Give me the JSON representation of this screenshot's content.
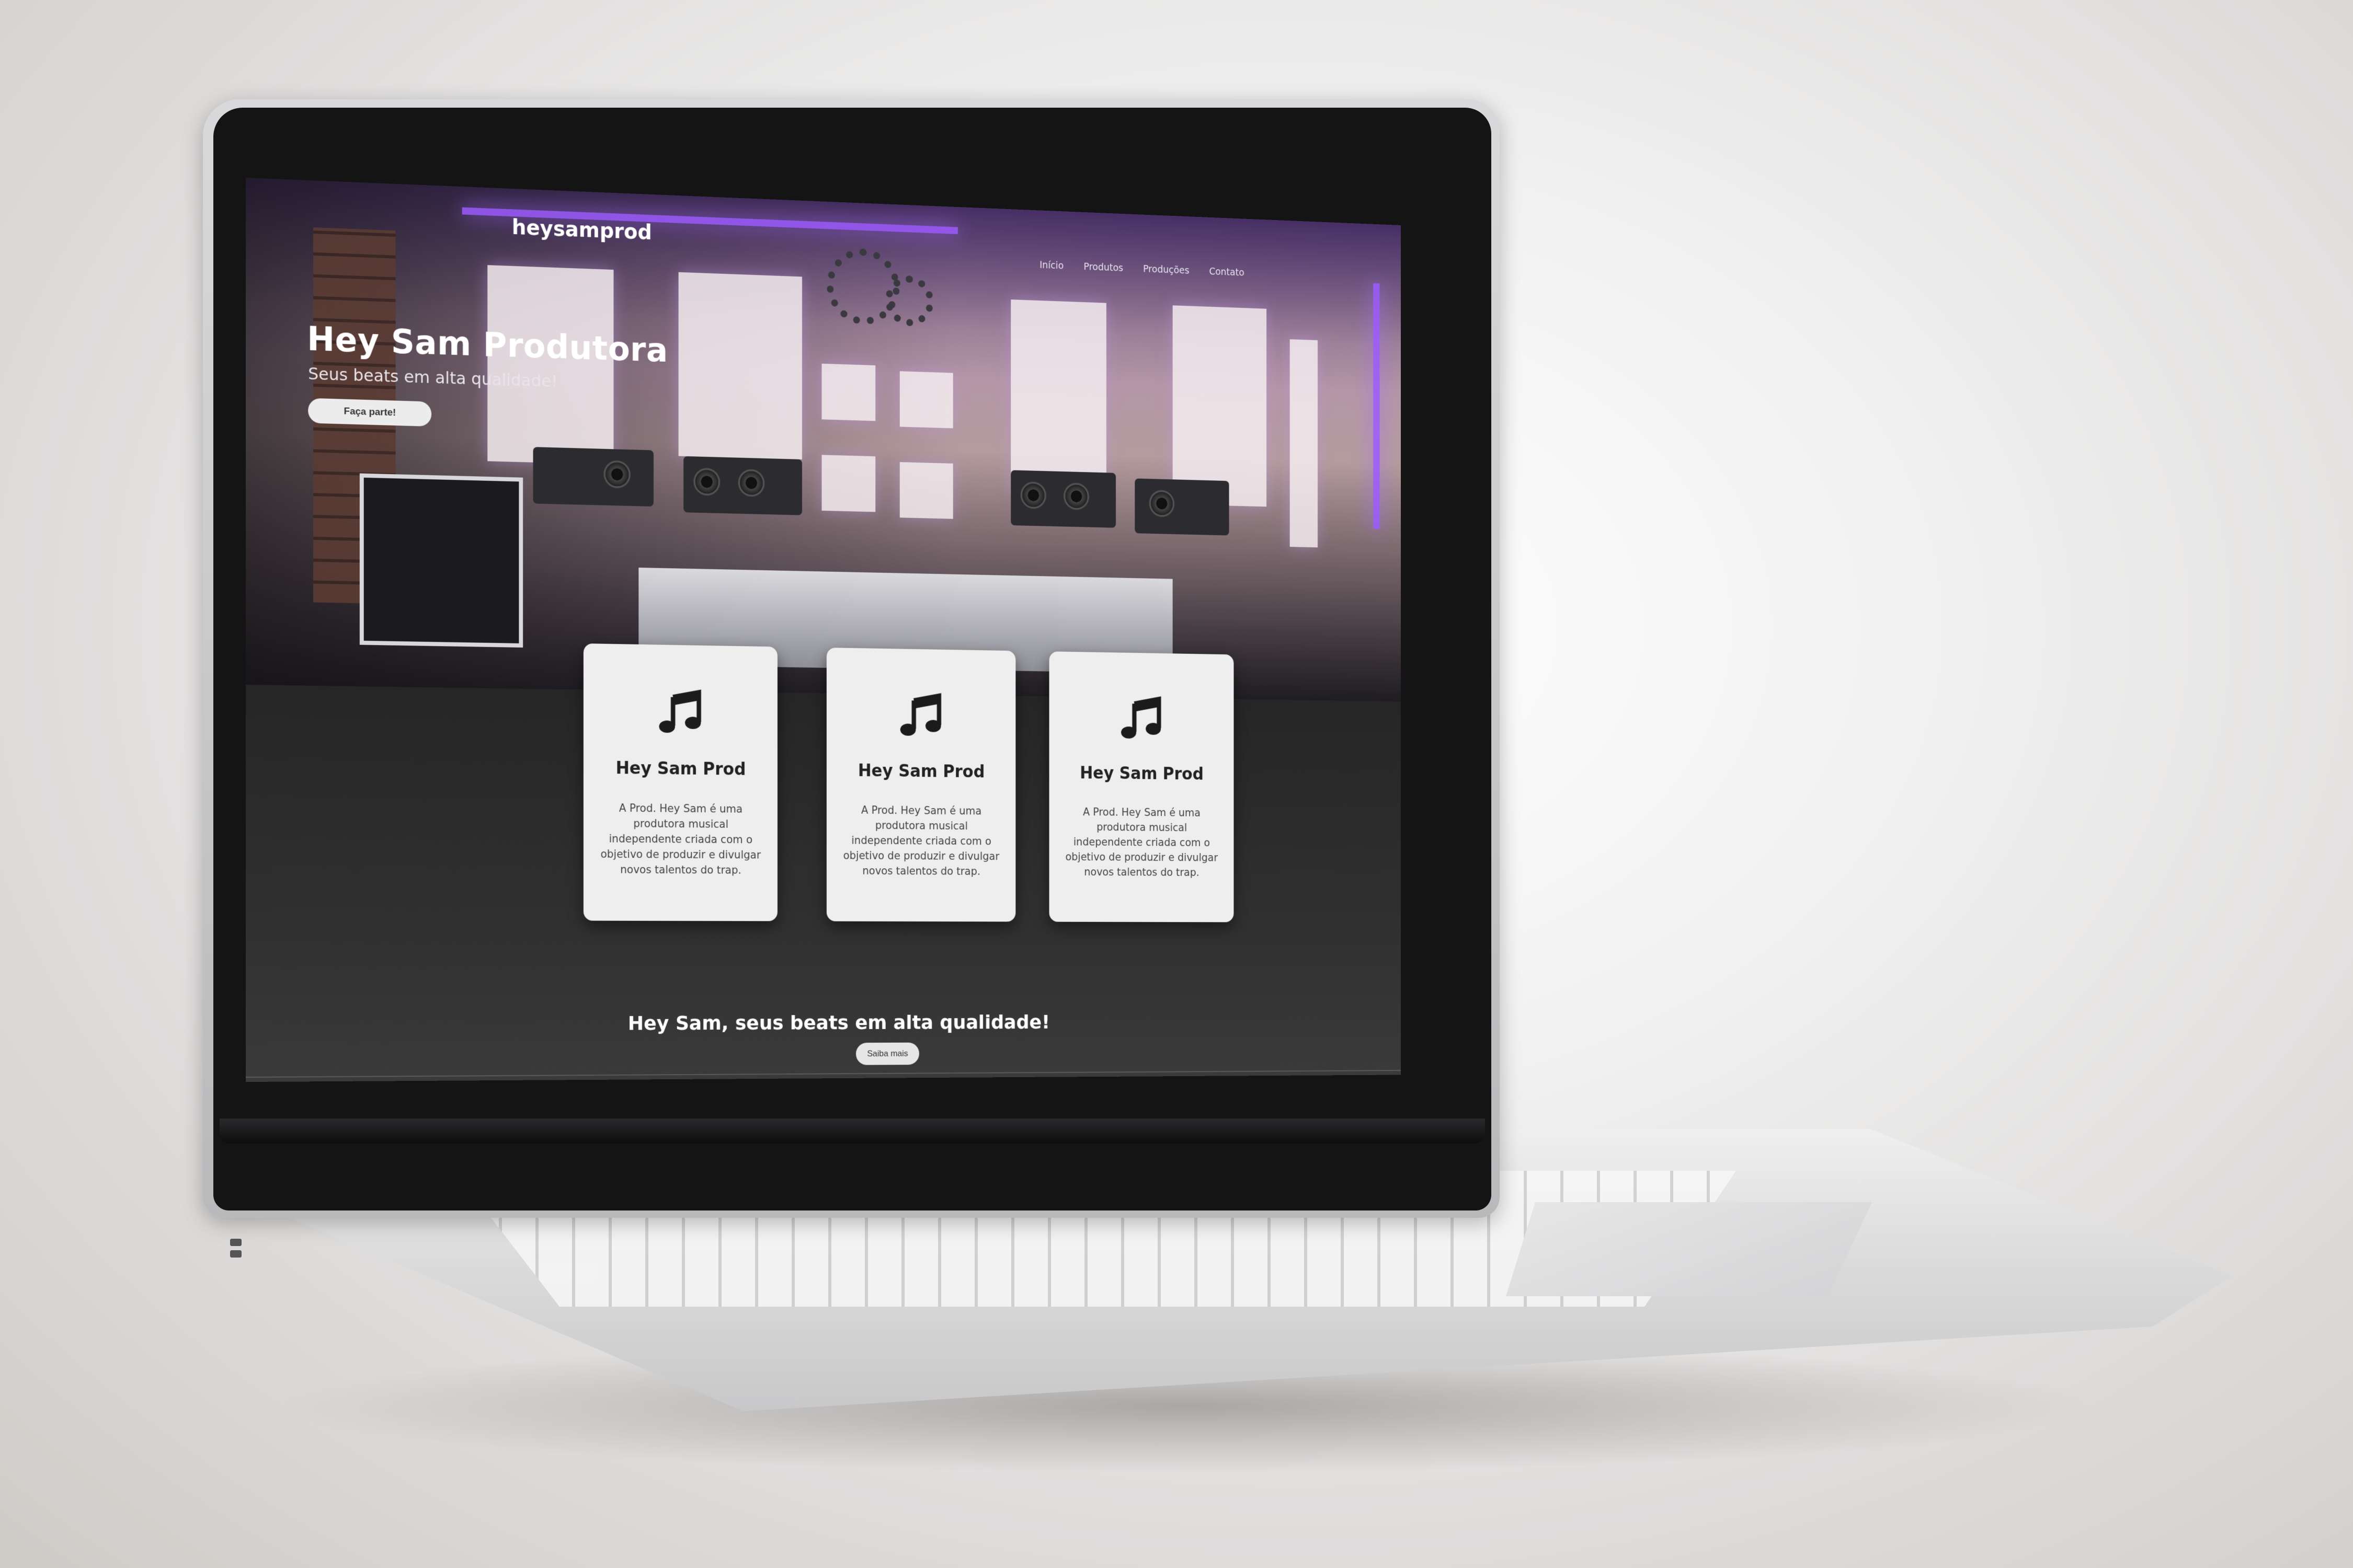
{
  "site": {
    "brand": "heysamprod",
    "nav": [
      "Início",
      "Produtos",
      "Produções",
      "Contato"
    ]
  },
  "hero": {
    "title": "Hey Sam Produtora",
    "subtitle": "Seus beats em alta qualidade!",
    "button_label": "Faça parte!"
  },
  "cards": [
    {
      "icon": "music-note-icon",
      "title": "Hey Sam Prod",
      "text": "A Prod. Hey Sam é uma produtora musical independente criada com o objetivo de produzir e divulgar novos talentos do trap."
    },
    {
      "icon": "music-note-icon",
      "title": "Hey Sam Prod",
      "text": "A Prod. Hey Sam é uma produtora musical independente criada com o objetivo de produzir e divulgar novos talentos do trap."
    },
    {
      "icon": "music-note-icon",
      "title": "Hey Sam Prod",
      "text": "A Prod. Hey Sam é uma produtora musical independente criada com o objetivo de produzir e divulgar novos talentos do trap."
    }
  ],
  "cta": {
    "title": "Hey Sam, seus beats em alta qualidade!",
    "button_label": "Saiba mais"
  },
  "colors": {
    "page_dark": "#262626",
    "card_bg": "#eeeeee",
    "accent_purple": "#9d5cff"
  }
}
